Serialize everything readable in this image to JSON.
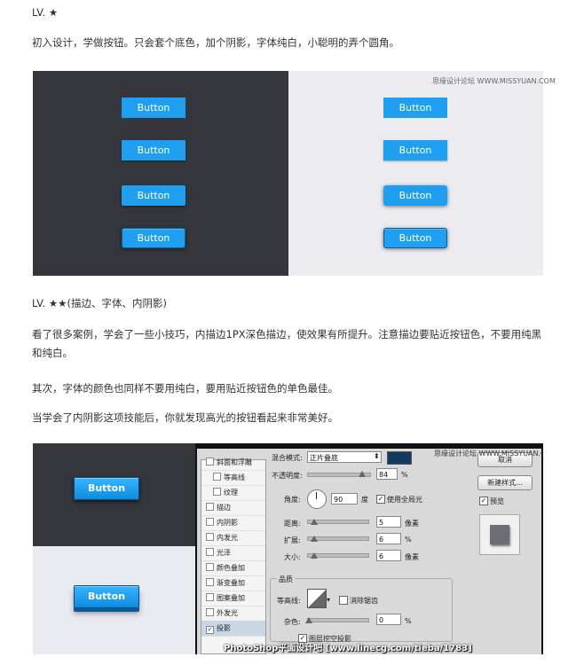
{
  "lv1": {
    "heading": "LV. ★",
    "desc": "初入设计，学做按钮。只会套个底色，加个阴影，字体纯白，小聪明的弄个圆角。"
  },
  "panel1": {
    "watermark": "思缘设计论坛 WWW.MISSYUAN.COM",
    "button_label": "Button",
    "dark_bg": "#35363b",
    "light_bg": "#ececf0",
    "button_color": "#1e9ff0"
  },
  "lv2": {
    "heading": "LV. ★★(描边、字体、内阴影)",
    "p1": "看了很多案例，学会了一些小技巧，内描边1PX深色描边，使效果有所提升。注意描边要贴近按钮色，不要用纯黑和纯白。",
    "p2": "其次，字体的颜色也同样不要用纯白，要用贴近按钮色的单色最佳。",
    "p3": "当学会了内阴影这项技能后，你就发现高光的按钮看起来非常美好。"
  },
  "panel2": {
    "button_label": "Button",
    "watermark": "思缘设计论坛 WWW.MISSYUAN.COM",
    "footer": "PhotoShop平面设计吧 [www.linecg.com/tieba/1783]",
    "styles_list": [
      "斜面和浮雕",
      "等高线",
      "纹理",
      "描边",
      "内阴影",
      "内发光",
      "光泽",
      "颜色叠加",
      "渐变叠加",
      "图案叠加",
      "外发光",
      "投影"
    ],
    "blend_mode_label": "混合模式:",
    "blend_mode_value": "正片叠底",
    "opacity_label": "不透明度:",
    "opacity_value": "84",
    "percent": "%",
    "angle_label": "角度:",
    "angle_value": "90",
    "degree": "度",
    "global_light_label": "使用全局光",
    "distance_label": "距离:",
    "distance_value": "5",
    "spread_label": "扩展:",
    "spread_value": "6",
    "size_label": "大小:",
    "size_value": "6",
    "px": "像素",
    "quality_label": "品质",
    "contour_label": "等高线:",
    "antialias_label": "消除锯齿",
    "noise_label": "杂色:",
    "noise_value": "0",
    "knockout_label": "图层挖空投影",
    "cancel_label": "取消",
    "new_style_label": "新建样式...",
    "preview_label": "预览"
  }
}
